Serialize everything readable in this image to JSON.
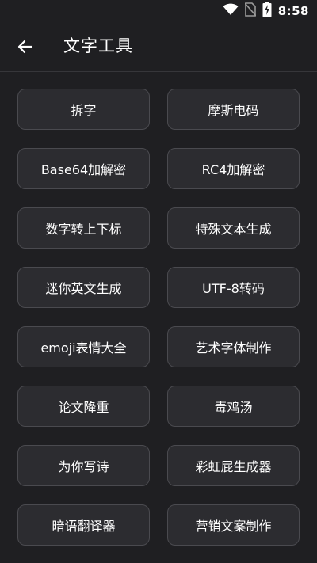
{
  "status_bar": {
    "time": "8:58",
    "icons": [
      "wifi-icon",
      "no-sim-icon",
      "battery-charging-icon"
    ]
  },
  "header": {
    "back_icon": "arrow-left-icon",
    "title": "文字工具"
  },
  "tools": [
    {
      "label": "拆字"
    },
    {
      "label": "摩斯电码"
    },
    {
      "label": "Base64加解密"
    },
    {
      "label": "RC4加解密"
    },
    {
      "label": "数字转上下标"
    },
    {
      "label": "特殊文本生成"
    },
    {
      "label": "迷你英文生成"
    },
    {
      "label": "UTF-8转码"
    },
    {
      "label": "emoji表情大全"
    },
    {
      "label": "艺术字体制作"
    },
    {
      "label": "论文降重"
    },
    {
      "label": "毒鸡汤"
    },
    {
      "label": "为你写诗"
    },
    {
      "label": "彩虹屁生成器"
    },
    {
      "label": "暗语翻译器"
    },
    {
      "label": "营销文案制作"
    }
  ],
  "colors": {
    "background": "#1f1f22",
    "button_background": "#2c2c30",
    "button_border": "#4a4a4f",
    "text": "#ffffff"
  }
}
